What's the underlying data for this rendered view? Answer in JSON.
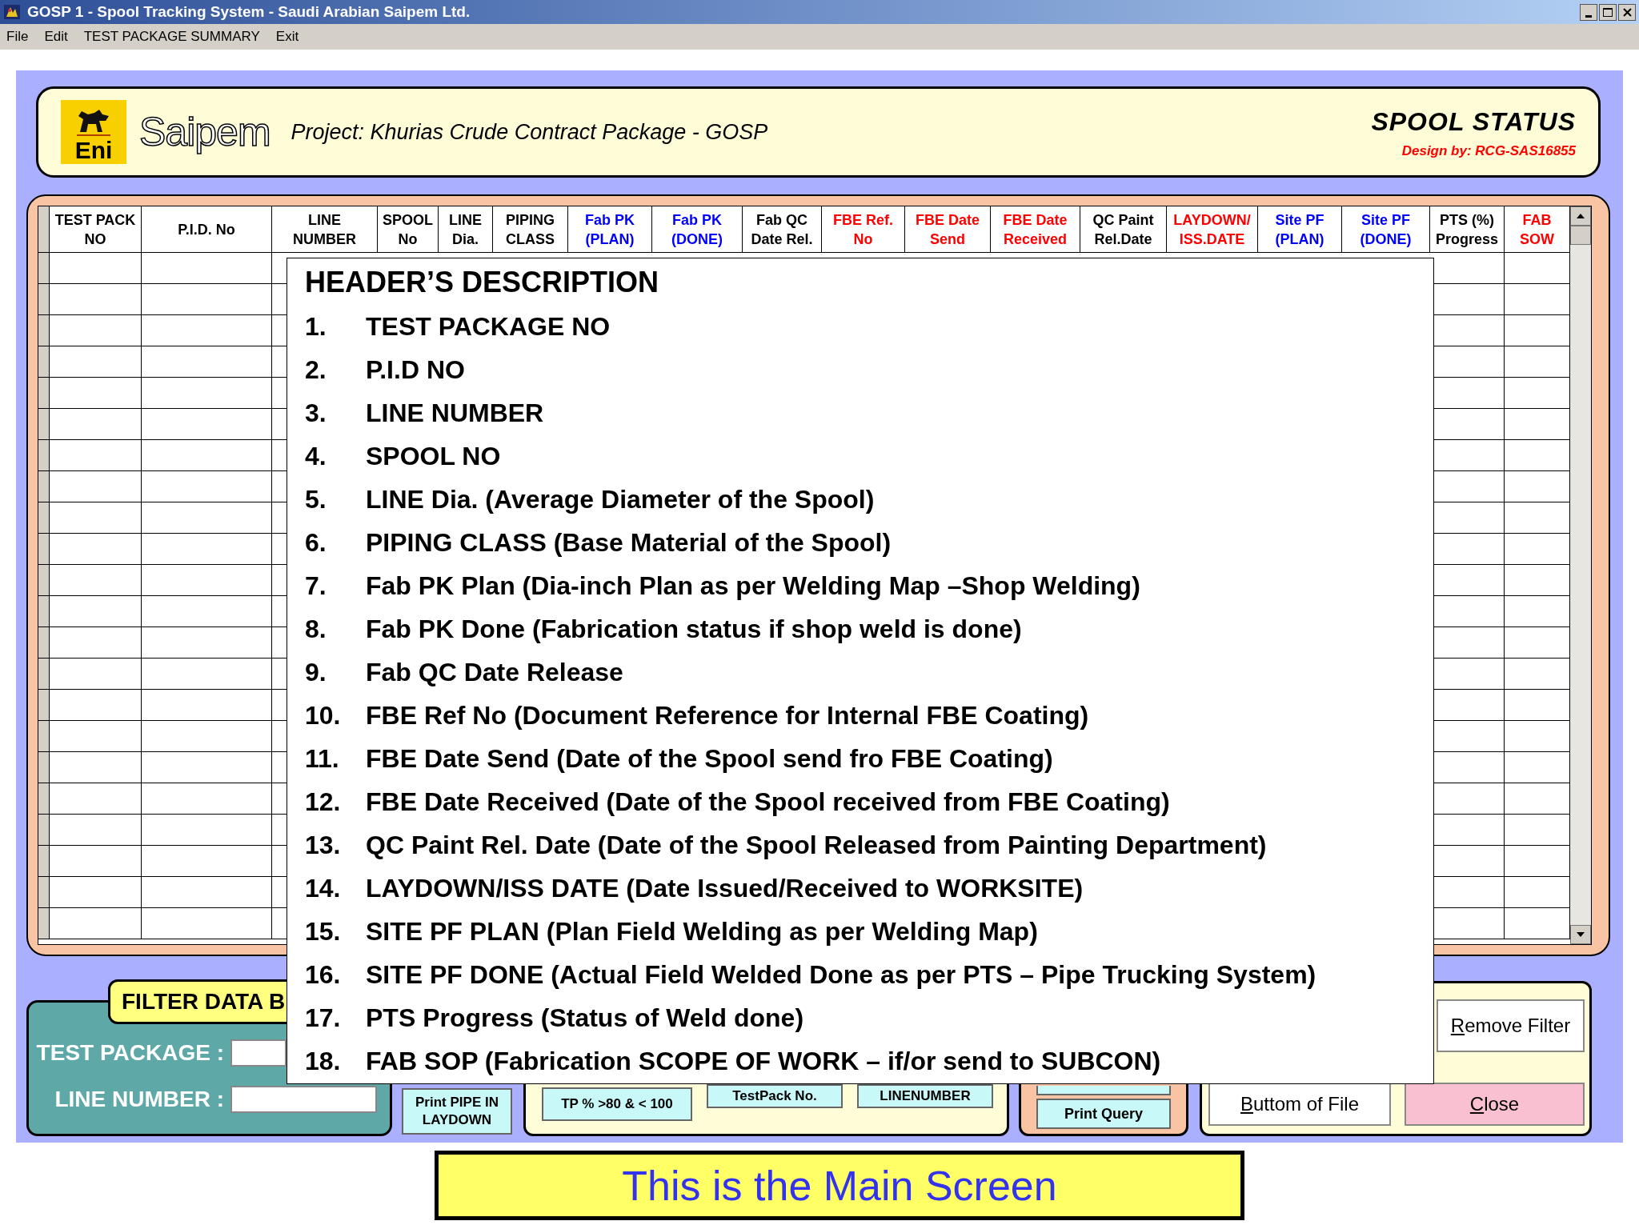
{
  "window": {
    "title": "GOSP 1 - Spool Tracking System - Saudi Arabian Saipem Ltd."
  },
  "menu": [
    "File",
    "Edit",
    "TEST PACKAGE SUMMARY",
    "Exit"
  ],
  "header": {
    "logo_badge": "Eni",
    "logo_name": "Saipem",
    "project": "Project: Khurias Crude Contract Package - GOSP",
    "title": "SPOOL STATUS",
    "credit": "Design by: RCG-SAS16855"
  },
  "table": {
    "columns": [
      {
        "label": "TEST PACK\nNO",
        "color": "#000000"
      },
      {
        "label": "P.I.D. No",
        "color": "#000000"
      },
      {
        "label": "LINE\nNUMBER",
        "color": "#000000"
      },
      {
        "label": "SPOOL\nNo",
        "color": "#000000"
      },
      {
        "label": "LINE\nDia.",
        "color": "#000000"
      },
      {
        "label": "PIPING\nCLASS",
        "color": "#000000"
      },
      {
        "label": "Fab PK\n(PLAN)",
        "color": "#0000ff"
      },
      {
        "label": "Fab PK\n(DONE)",
        "color": "#0000ff"
      },
      {
        "label": "Fab QC\nDate Rel.",
        "color": "#000000"
      },
      {
        "label": "FBE Ref.\nNo",
        "color": "#ff0000"
      },
      {
        "label": "FBE  Date\nSend",
        "color": "#ff0000"
      },
      {
        "label": "FBE Date\nReceived",
        "color": "#ff0000"
      },
      {
        "label": "QC Paint\nRel.Date",
        "color": "#000000"
      },
      {
        "label": "LAYDOWN/\nISS.DATE",
        "color": "#ff0000"
      },
      {
        "label": "Site PF\n(PLAN)",
        "color": "#0000ff"
      },
      {
        "label": "Site PF\n(DONE)",
        "color": "#0000ff"
      },
      {
        "label": "PTS (%)\nProgress",
        "color": "#000000"
      },
      {
        "label": "FAB\nSOW",
        "color": "#ff0000"
      }
    ]
  },
  "description": {
    "title": "HEADER’S DESCRIPTION",
    "items": [
      {
        "number": "1.",
        "text": "TEST PACKAGE NO"
      },
      {
        "number": "2.",
        "text": "P.I.D NO"
      },
      {
        "number": "3.",
        "text": "LINE NUMBER"
      },
      {
        "number": "4.",
        "text": "SPOOL NO"
      },
      {
        "number": "5.",
        "text": "LINE Dia. (Average Diameter of the Spool)"
      },
      {
        "number": "6.",
        "text": "PIPING CLASS (Base Material of the Spool)"
      },
      {
        "number": "7.",
        "text": "Fab PK Plan (Dia-inch Plan as per Welding Map –Shop Welding)"
      },
      {
        "number": "8.",
        "text": "Fab PK Done (Fabrication status if shop weld is done)"
      },
      {
        "number": "9.",
        "text": "Fab QC Date Release"
      },
      {
        "number": "10.",
        "text": "FBE Ref No (Document Reference for Internal FBE Coating)"
      },
      {
        "number": "11.",
        "text": "FBE Date Send (Date of the Spool send fro FBE Coating)"
      },
      {
        "number": "12.",
        "text": "FBE Date Received (Date of the Spool received from FBE Coating)"
      },
      {
        "number": "13.",
        "text": "QC Paint Rel. Date (Date of the Spool Released from Painting Department)"
      },
      {
        "number": "14.",
        "text": "LAYDOWN/ISS DATE (Date Issued/Received to WORKSITE)"
      },
      {
        "number": "15.",
        "text": "SITE PF PLAN (Plan Field Welding as per Welding Map)"
      },
      {
        "number": "16.",
        "text": "SITE PF DONE (Actual Field Welded Done as per PTS – Pipe Trucking System)"
      },
      {
        "number": "17.",
        "text": "PTS Progress (Status of Weld done)"
      },
      {
        "number": "18.",
        "text": "FAB SOP (Fabrication SCOPE OF WORK – if/or send to SUBCON)"
      }
    ]
  },
  "filter": {
    "tab": "FILTER DATA B",
    "fields": [
      {
        "label": "TEST PACKAGE :"
      },
      {
        "label": "LINE NUMBER :"
      }
    ]
  },
  "print_laydown": "Print PIPE IN\nLAYDOWN",
  "query_buttons": [
    "TP % >80 & < 100",
    "TestPack No.",
    "LINENUMBER"
  ],
  "print_query": "Print Query",
  "nav_buttons": [
    {
      "kind": "remove",
      "key": "R",
      "rest": "emove Filter"
    },
    {
      "kind": "bottom",
      "key": "B",
      "rest": "uttom of File"
    },
    {
      "kind": "close",
      "key": "C",
      "rest": "lose"
    }
  ],
  "banner": "This is the Main Screen"
}
